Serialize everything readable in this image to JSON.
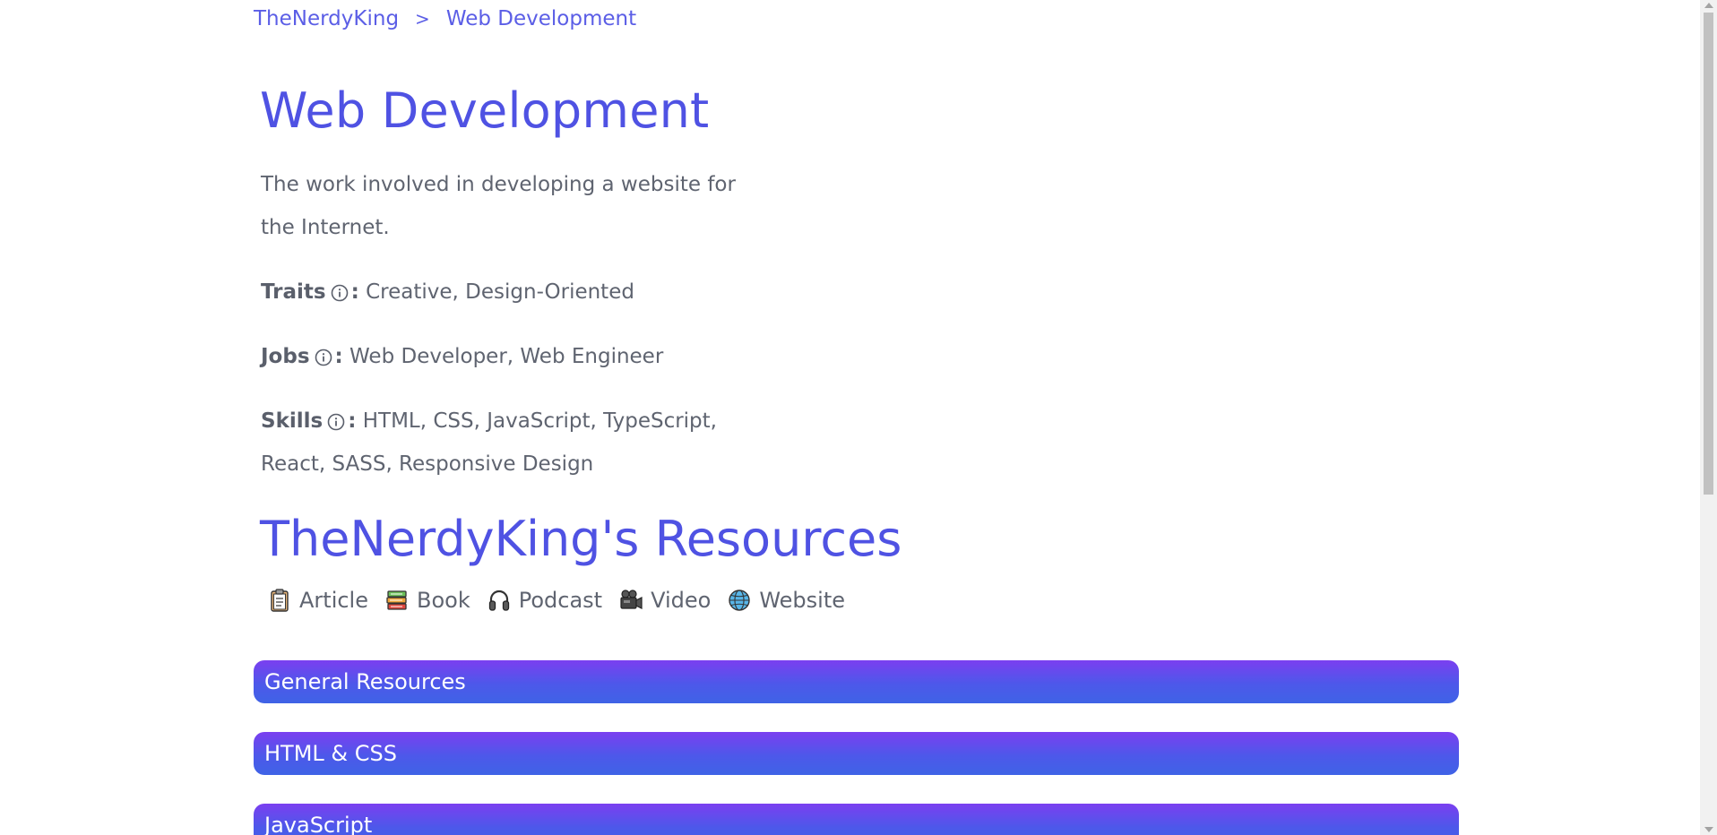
{
  "breadcrumb": {
    "home": "TheNerdyKing",
    "separator": ">",
    "current": "Web Development"
  },
  "title": "Web Development",
  "description": "The work involved in developing a website for the Internet.",
  "traits": {
    "label": "Traits",
    "colon": ":",
    "value": "Creative, Design-Oriented"
  },
  "jobs": {
    "label": "Jobs",
    "colon": ":",
    "value": "Web Developer, Web Engineer"
  },
  "skills": {
    "label": "Skills",
    "colon": ":",
    "value": "HTML, CSS, JavaScript, TypeScript, React, SASS, Responsive Design"
  },
  "resources": {
    "title": "TheNerdyKing's Resources",
    "legend": [
      {
        "icon": "clipboard-icon",
        "label": "Article"
      },
      {
        "icon": "books-icon",
        "label": "Book"
      },
      {
        "icon": "headphones-icon",
        "label": "Podcast"
      },
      {
        "icon": "video-camera-icon",
        "label": "Video"
      },
      {
        "icon": "globe-icon",
        "label": "Website"
      }
    ],
    "sections": [
      {
        "label": "General Resources"
      },
      {
        "label": "HTML & CSS"
      },
      {
        "label": "JavaScript"
      }
    ]
  },
  "colors": {
    "accent": "#4f52e3",
    "link": "#5b5ee6",
    "body_text": "#5f6470",
    "accordion_gradient_top": "#7b3ff0",
    "accordion_gradient_bottom": "#3f63e6"
  }
}
